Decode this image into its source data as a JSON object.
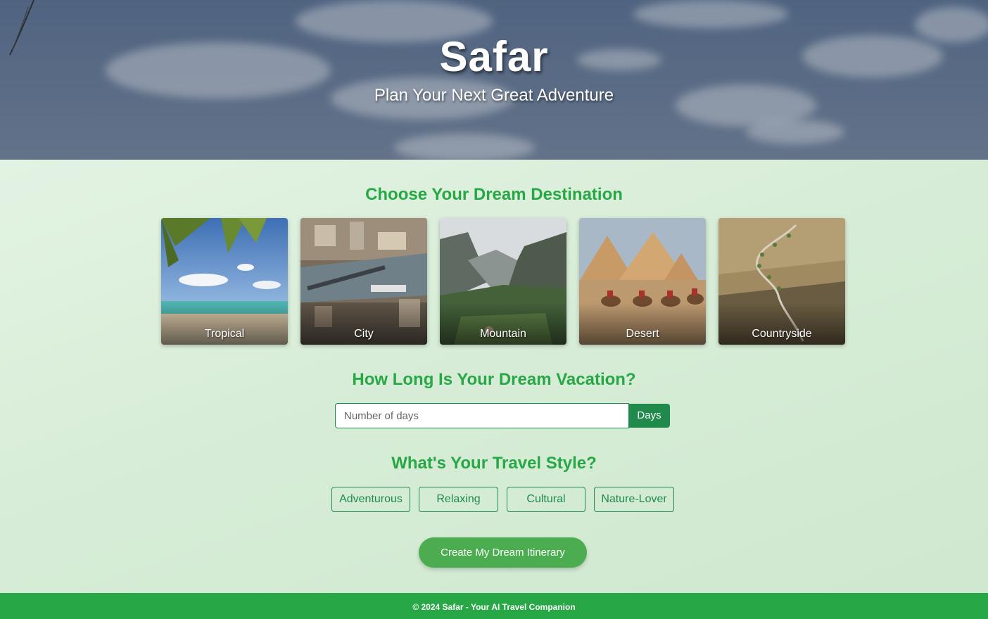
{
  "hero": {
    "title": "Safar",
    "subtitle": "Plan Your Next Great Adventure"
  },
  "destinations": {
    "heading": "Choose Your Dream Destination",
    "items": [
      {
        "label": "Tropical"
      },
      {
        "label": "City"
      },
      {
        "label": "Mountain"
      },
      {
        "label": "Desert"
      },
      {
        "label": "Countryside"
      }
    ]
  },
  "duration": {
    "heading": "How Long Is Your Dream Vacation?",
    "placeholder": "Number of days",
    "value": "",
    "addon": "Days"
  },
  "style": {
    "heading": "What's Your Travel Style?",
    "options": [
      {
        "label": "Adventurous"
      },
      {
        "label": "Relaxing"
      },
      {
        "label": "Cultural"
      },
      {
        "label": "Nature-Lover"
      }
    ]
  },
  "cta": {
    "label": "Create My Dream Itinerary"
  },
  "footer": {
    "text": "© 2024 Safar - Your AI Travel Companion"
  },
  "colors": {
    "accent_green": "#27a745",
    "dark_green": "#1f8a4c",
    "cta_green": "#4bad4f",
    "page_background": "#dcefdc"
  }
}
